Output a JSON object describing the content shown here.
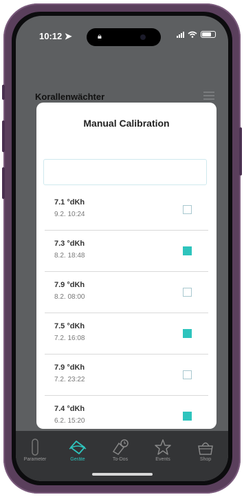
{
  "status": {
    "time": "10:12"
  },
  "app": {
    "title": "Korallenwächter"
  },
  "modal": {
    "title": "Manual Calibration",
    "input_value": "",
    "rows": [
      {
        "value": "7.1 °dKh",
        "timestamp": "9.2. 10:24",
        "checked": false
      },
      {
        "value": "7.3 °dKh",
        "timestamp": "8.2. 18:48",
        "checked": true
      },
      {
        "value": "7.9 °dKh",
        "timestamp": "8.2. 08:00",
        "checked": false
      },
      {
        "value": "7.5 °dKh",
        "timestamp": "7.2. 16:08",
        "checked": true
      },
      {
        "value": "7.9 °dKh",
        "timestamp": "7.2. 23:22",
        "checked": false
      },
      {
        "value": "7.4 °dKh",
        "timestamp": "6.2. 15:20",
        "checked": true
      }
    ]
  },
  "tabs": [
    {
      "label": "Parameter",
      "icon": "test-tube-icon",
      "active": false
    },
    {
      "label": "Geräte",
      "icon": "devices-icon",
      "active": true
    },
    {
      "label": "To-Dos",
      "icon": "todo-icon",
      "active": false
    },
    {
      "label": "Events",
      "icon": "star-icon",
      "active": false
    },
    {
      "label": "Shop",
      "icon": "basket-icon",
      "active": false
    }
  ],
  "colors": {
    "accent": "#2ec4bd",
    "frame": "#5a3f5c",
    "overlay": "#5d5f61",
    "tabbar": "#333436"
  }
}
